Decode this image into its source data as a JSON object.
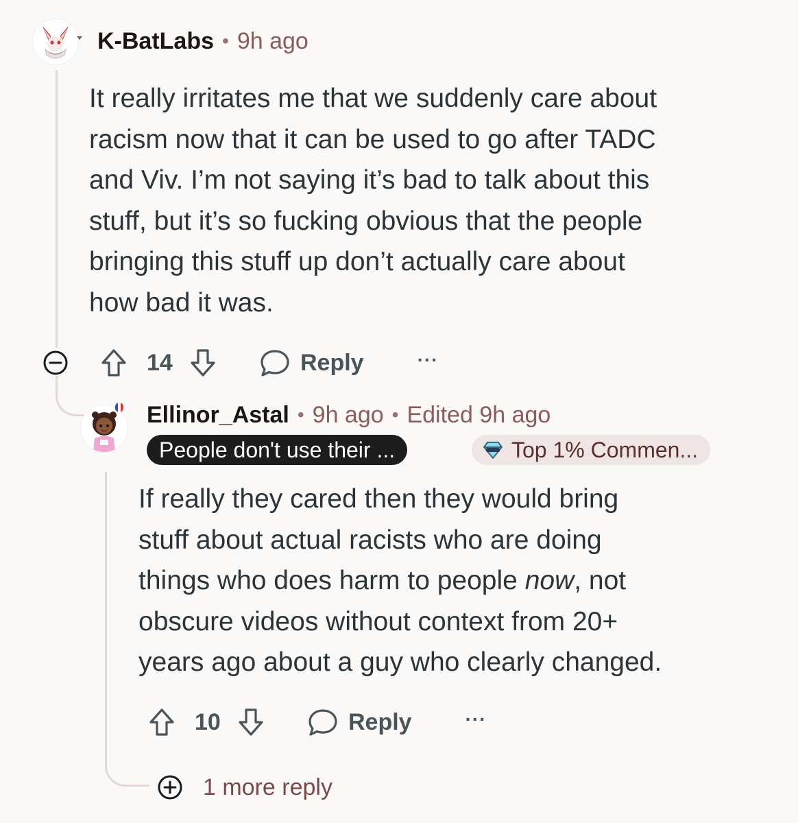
{
  "comment": {
    "username": "K-BatLabs",
    "separator": "•",
    "time": "9h ago",
    "body_lines": [
      "It really irritates me that we suddenly care about",
      "racism now that it can be used to go after TADC",
      "and Viv. I’m not saying it’s bad to talk about this",
      "stuff, but it’s so fucking obvious that the people",
      "bringing this stuff up don’t actually care about",
      "how bad it was."
    ],
    "votes": "14",
    "reply_label": "Reply",
    "more_label": "···"
  },
  "reply": {
    "username": "Ellinor_Astal",
    "separator": "•",
    "time": "9h ago",
    "edited": "Edited 9h ago",
    "flair_user": "People don't use their ...",
    "flair_badge": "Top 1% Commen...",
    "body_line1": "If really they cared then they would bring",
    "body_line2": "stuff about actual racists who are doing",
    "body_line3_pre": "things who does harm to people ",
    "body_line3_em": "now",
    "body_line3_post": ", not",
    "body_line4": "obscure videos without context from 20+",
    "body_line5": "years ago about a guy who clearly changed.",
    "votes": "10",
    "reply_label": "Reply",
    "more_label": "···"
  },
  "more_replies": {
    "label": "1 more reply"
  },
  "colors": {
    "thread_line": "#e6d6d6",
    "username": "#1f1414",
    "time": "#8a5c5c",
    "body": "#2b3539",
    "flair_dark_bg": "#1d1d1d",
    "flair_light_bg": "#f0e5e5"
  }
}
